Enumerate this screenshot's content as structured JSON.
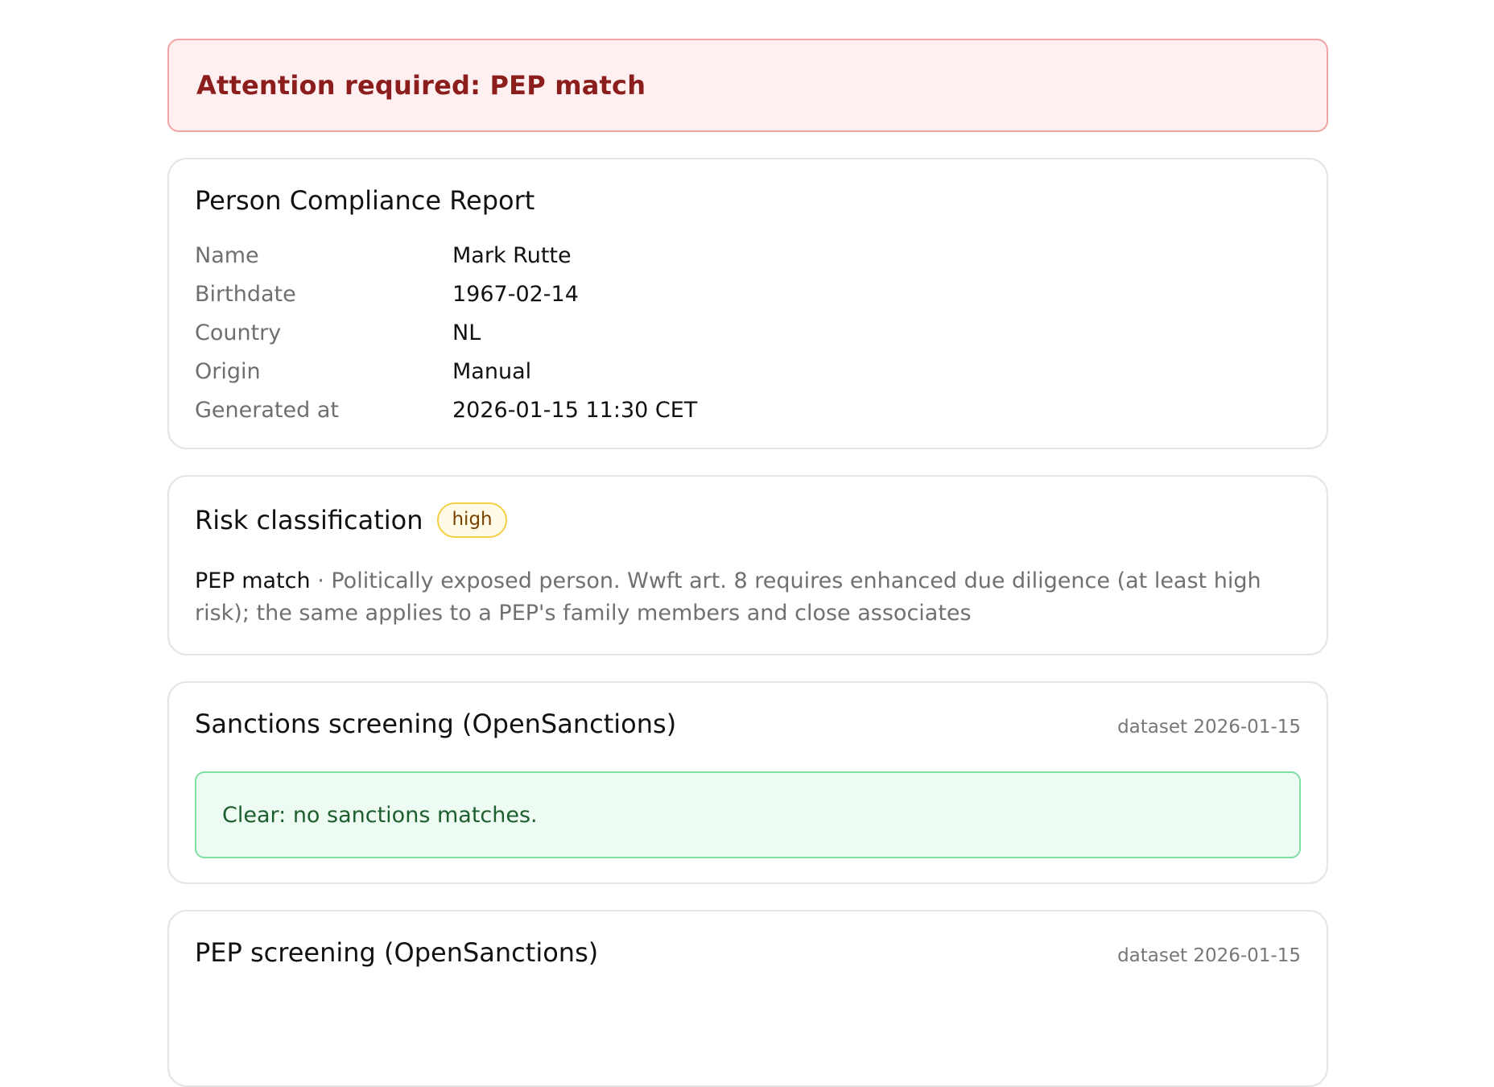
{
  "alert": {
    "text": "Attention required: PEP match",
    "color": "#8c1d1d"
  },
  "report": {
    "title": "Person Compliance Report",
    "fields": [
      {
        "label": "Name",
        "value": "Mark Rutte"
      },
      {
        "label": "Birthdate",
        "value": "1967-02-14"
      },
      {
        "label": "Country",
        "value": "NL"
      },
      {
        "label": "Origin",
        "value": "Manual"
      },
      {
        "label": "Generated at",
        "value": "2026-01-15 11:30 CET"
      }
    ]
  },
  "risk": {
    "title": "Risk classification",
    "level": "high",
    "reason_label": "PEP match",
    "separator": " · ",
    "reason_text": "Politically exposed person. Wwft art. 8 requires enhanced due diligence (at least high risk); the same applies to a PEP's family members and close associates"
  },
  "sanctions": {
    "title": "Sanctions screening (OpenSanctions)",
    "dataset": "dataset 2026-01-15",
    "status_text": "Clear: no sanctions matches."
  },
  "pep": {
    "title": "PEP screening (OpenSanctions)",
    "dataset": "dataset 2026-01-15"
  }
}
